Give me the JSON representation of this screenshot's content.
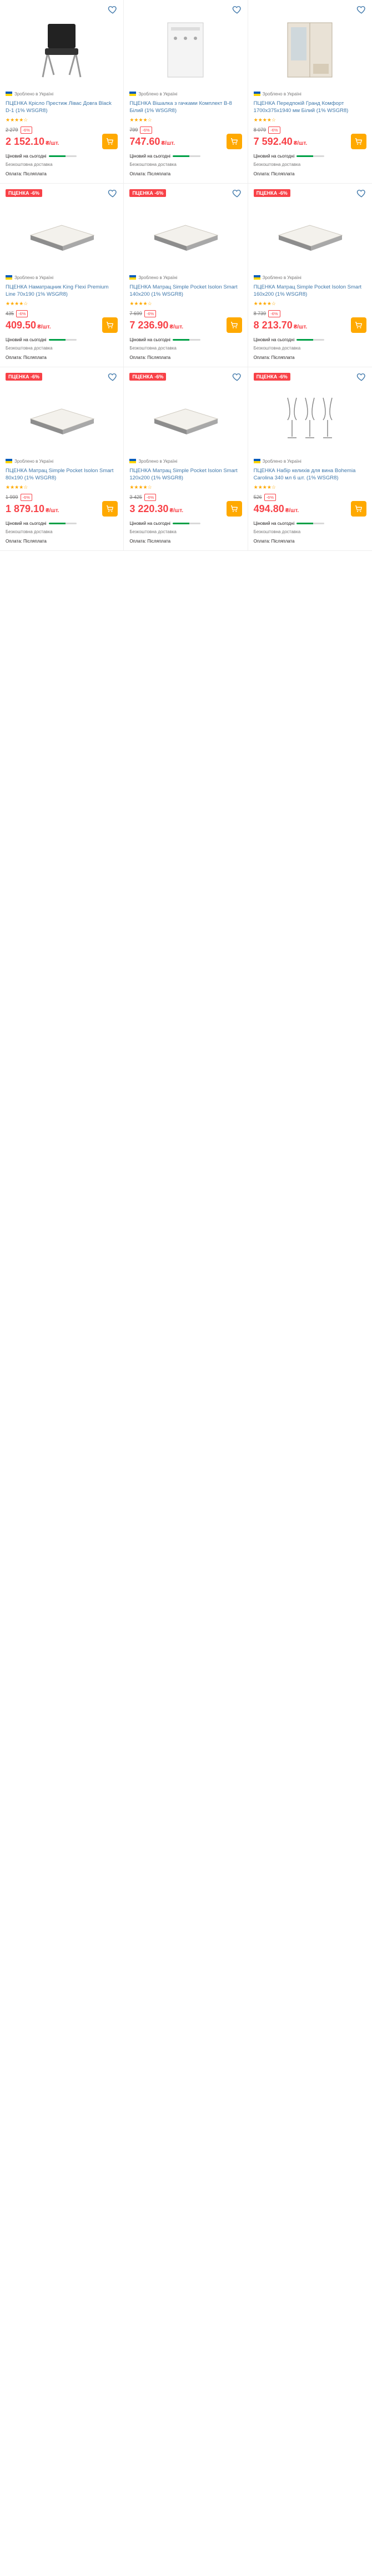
{
  "page": {
    "currency": "₴/шт.",
    "cart_icon": "cart-icon",
    "heart_icon": "heart-icon",
    "accent": "#ffa900",
    "price_red": "#f84147"
  },
  "products": [
    {
      "promo": "",
      "img": "chair",
      "meta": "Зроблено в Україні",
      "seller": "flag",
      "title": "ПЦЕНКА Крісло Престиж Лівас Довга Black D-1 (1% WSGR8)",
      "rating": "★★★★☆",
      "reviews": "",
      "old": "2 279",
      "badge": "-6%",
      "price": "2 152.10",
      "red": true,
      "bonus": "Ціновий на сьогодні",
      "ship": "Безкоштовна доставка",
      "extra": "Оплата: Післяплата",
      "extra2": ""
    },
    {
      "promo": "",
      "img": "shelf",
      "meta": "Зроблено в Україні",
      "seller": "flag",
      "title": "ПЦЕНКА Вішалка з гачками Комплект В-8 Білий (1% WSGR8)",
      "rating": "★★★★☆",
      "reviews": "",
      "old": "799",
      "badge": "-6%",
      "price": "747.60",
      "red": true,
      "bonus": "Ціновий на сьогодні",
      "ship": "Безкоштовна доставка",
      "extra": "Оплата: Післяплата",
      "extra2": ""
    },
    {
      "promo": "",
      "img": "wardrobe",
      "meta": "Зроблено в Україні",
      "seller": "flag",
      "title": "ПЦЕНКА Передпокій Гранд Комфорт 1700x375x1940 мм Білий (1% WSGR8)",
      "rating": "★★★★☆",
      "reviews": "",
      "old": "8 079",
      "badge": "-6%",
      "price": "7 592.40",
      "red": true,
      "bonus": "Ціновий на сьогодні",
      "ship": "Безкоштовна доставка",
      "extra": "Оплата: Післяплата",
      "extra2": ""
    },
    {
      "promo": "ПЦЕНКА -6%",
      "img": "mattress",
      "meta": "Зроблено в Україні",
      "seller": "flag",
      "title": "ПЦЕНКА Наматрацник King Flexi Premium Line 70x190 (1% WSGR8)",
      "rating": "★★★★☆",
      "reviews": "",
      "old": "435",
      "badge": "-6%",
      "price": "409.50",
      "red": true,
      "bonus": "Ціновий на сьогодні",
      "ship": "Безкоштовна доставка",
      "extra": "Оплата: Післяплата",
      "extra2": ""
    },
    {
      "promo": "ПЦЕНКА -6%",
      "img": "mattress",
      "meta": "Зроблено в Україні",
      "seller": "flag",
      "title": "ПЦЕНКА Матрац Simple Pocket Isolon Smart 140x200 (1% WSGR8)",
      "rating": "★★★★☆",
      "reviews": "",
      "old": "7 699",
      "badge": "-6%",
      "price": "7 236.90",
      "red": true,
      "bonus": "Ціновий на сьогодні",
      "ship": "Безкоштовна доставка",
      "extra": "Оплата: Післяплата",
      "extra2": ""
    },
    {
      "promo": "ПЦЕНКА -6%",
      "img": "mattress",
      "meta": "Зроблено в Україні",
      "seller": "flag",
      "title": "ПЦЕНКА Матрац Simple Pocket Isolon Smart 160x200 (1% WSGR8)",
      "rating": "★★★★☆",
      "reviews": "",
      "old": "8 739",
      "badge": "-6%",
      "price": "8 213.70",
      "red": true,
      "bonus": "Ціновий на сьогодні",
      "ship": "Безкоштовна доставка",
      "extra": "Оплата: Післяплата",
      "extra2": ""
    },
    {
      "promo": "ПЦЕНКА -6%",
      "img": "mattress",
      "meta": "Зроблено в Україні",
      "seller": "flag",
      "title": "ПЦЕНКА Матрац Simple Pocket Isolon Smart 80x190 (1% WSGR8)",
      "rating": "★★★★☆",
      "reviews": "",
      "old": "1 999",
      "badge": "-6%",
      "price": "1 879.10",
      "red": true,
      "bonus": "Ціновий на сьогодні",
      "ship": "Безкоштовна доставка",
      "extra": "Оплата: Післяплата",
      "extra2": ""
    },
    {
      "promo": "ПЦЕНКА -6%",
      "img": "mattress",
      "meta": "Зроблено в Україні",
      "seller": "flag",
      "title": "ПЦЕНКА Матрац Simple Pocket Isolon Smart 120x200 (1% WSGR8)",
      "rating": "★★★★☆",
      "reviews": "",
      "old": "3 425",
      "badge": "-6%",
      "price": "3 220.30",
      "red": true,
      "bonus": "Ціновий на сьогодні",
      "ship": "Безкоштовна доставка",
      "extra": "Оплата: Післяплата",
      "extra2": ""
    },
    {
      "promo": "ПЦЕНКА -6%",
      "img": "glasses",
      "meta": "Зроблено в Україні",
      "seller": "flag",
      "title": "ПЦЕНКА Набір келихів для вина Bohemia Carolina 340 мл 6 шт. (1% WSGR8)",
      "rating": "★★★★☆",
      "reviews": "",
      "old": "526",
      "badge": "-6%",
      "price": "494.80",
      "red": true,
      "bonus": "Ціновий на сьогодні",
      "ship": "Безкоштовна доставка",
      "extra": "Оплата: Післяплата",
      "extra2": ""
    }
  ]
}
